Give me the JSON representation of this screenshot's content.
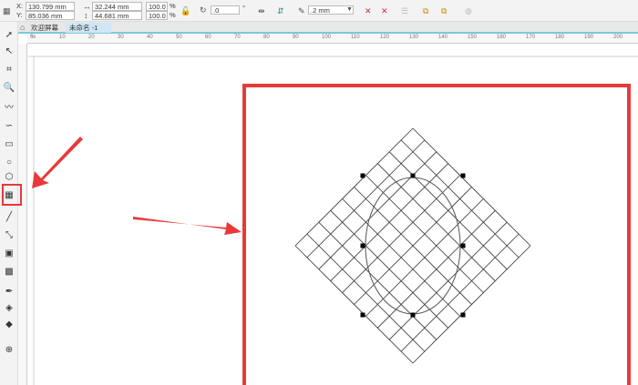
{
  "properties": {
    "x": "130.799 mm",
    "y": "85.036 mm",
    "width": "32.244 mm",
    "height": "44.681 mm",
    "scale_x": "100.0",
    "scale_y": "100.0",
    "percent": "%",
    "rotation": ".0",
    "degree": "°",
    "outline": ".2 mm",
    "x_label": "X:",
    "y_label": "Y:"
  },
  "tabs": [
    {
      "label": "欢迎屏幕"
    },
    {
      "label": "未命名 -1"
    }
  ],
  "ruler": {
    "labels": [
      "0",
      "10",
      "20",
      "30",
      "40",
      "50",
      "60",
      "70",
      "80",
      "90",
      "100",
      "110",
      "120",
      "130",
      "140",
      "150",
      "160",
      "170",
      "180",
      "190",
      "200"
    ],
    "unit": "%"
  },
  "tools": [
    "pick-tool",
    "shape-tool",
    "crop-tool",
    "zoom-tool",
    "freehand-tool",
    "artistic-media-tool",
    "rectangle-tool",
    "ellipse-tool",
    "polygon-tool",
    "graph-paper-tool",
    "dimension-tool",
    "connector-tool",
    "drop-shadow-tool",
    "transparency-tool",
    "eyedropper-tool",
    "fill-tool",
    "smart-fill-tool",
    "add-tool"
  ],
  "colors": {
    "highlight": "#e8393a",
    "grid": "#333333",
    "tab_active": "#cfe6f5"
  },
  "graph_paper": {
    "rows": 10,
    "columns": 10,
    "rotation_deg": 45
  }
}
